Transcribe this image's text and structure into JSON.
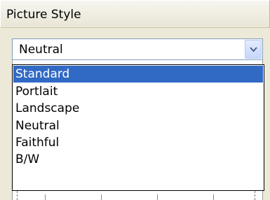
{
  "header": {
    "title": "Picture Style"
  },
  "combo": {
    "value": "Neutral",
    "button_icon": "chevron-down-icon"
  },
  "dropdown": {
    "items": [
      {
        "label": "Standard",
        "selected": true
      },
      {
        "label": "Portlait",
        "selected": false
      },
      {
        "label": "Landscape",
        "selected": false
      },
      {
        "label": "Neutral",
        "selected": false
      },
      {
        "label": "Faithful",
        "selected": false
      },
      {
        "label": "B/W",
        "selected": false
      }
    ]
  },
  "colors": {
    "selection": "#316ac5",
    "panel": "#ece9d8",
    "combo_border": "#7f9db9"
  }
}
